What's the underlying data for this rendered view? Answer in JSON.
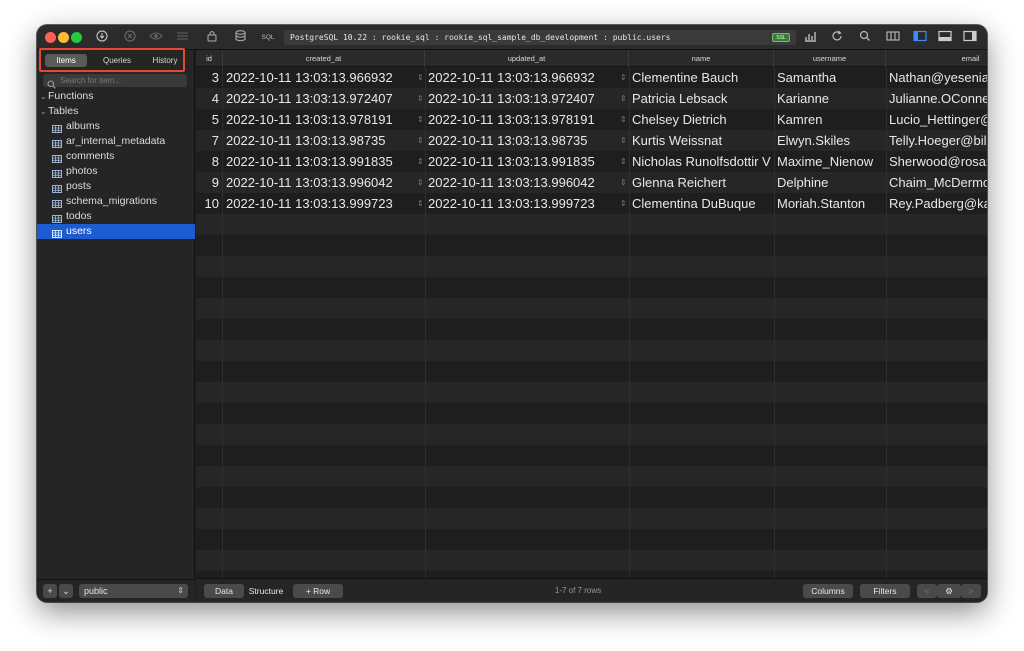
{
  "connection": {
    "path": "PostgreSQL 10.22 : rookie_sql : rookie_sql_sample_db_development : public.users",
    "badge": "SSL",
    "sql_label": "SQL"
  },
  "sidebar": {
    "tabs": [
      "Items",
      "Queries",
      "History"
    ],
    "active_tab": "Items",
    "search_placeholder": "Search for item...",
    "groups": [
      {
        "label": "Functions"
      },
      {
        "label": "Tables"
      }
    ],
    "tables": [
      "albums",
      "ar_internal_metadata",
      "comments",
      "photos",
      "posts",
      "schema_migrations",
      "todos",
      "users"
    ],
    "selected_table": "users",
    "schema": "public",
    "add_label": "+",
    "options_label": "⌄",
    "chevron_down": "⌄"
  },
  "grid": {
    "columns": [
      "id",
      "created_at",
      "updated_at",
      "name",
      "username",
      "email"
    ],
    "rows": [
      [
        "3",
        "2022-10-11 13:03:13.966932",
        "2022-10-11 13:03:13.966932",
        "Clementine Bauch",
        "Samantha",
        "Nathan@yesenia."
      ],
      [
        "4",
        "2022-10-11 13:03:13.972407",
        "2022-10-11 13:03:13.972407",
        "Patricia Lebsack",
        "Karianne",
        "Julianne.OConne"
      ],
      [
        "5",
        "2022-10-11 13:03:13.978191",
        "2022-10-11 13:03:13.978191",
        "Chelsey Dietrich",
        "Kamren",
        "Lucio_Hettinger@"
      ],
      [
        "7",
        "2022-10-11 13:03:13.98735",
        "2022-10-11 13:03:13.98735",
        "Kurtis Weissnat",
        "Elwyn.Skiles",
        "Telly.Hoeger@bill"
      ],
      [
        "8",
        "2022-10-11 13:03:13.991835",
        "2022-10-11 13:03:13.991835",
        "Nicholas Runolfsdottir V",
        "Maxime_Nienow",
        "Sherwood@rosam"
      ],
      [
        "9",
        "2022-10-11 13:03:13.996042",
        "2022-10-11 13:03:13.996042",
        "Glenna Reichert",
        "Delphine",
        "Chaim_McDermo"
      ],
      [
        "10",
        "2022-10-11 13:03:13.999723",
        "2022-10-11 13:03:13.999723",
        "Clementina DuBuque",
        "Moriah.Stanton",
        "Rey.Padberg@ka"
      ]
    ]
  },
  "bottombar": {
    "data_label": "Data",
    "structure_label": "Structure",
    "row_label": "+ Row",
    "row_count": "1-7 of 7 rows",
    "columns_label": "Columns",
    "filters_label": "Filters",
    "prev_label": "<",
    "settings_label": "⚙",
    "next_label": ">"
  },
  "colors": {
    "accent": "#1c5bd0",
    "highlight_border": "#e64a2e",
    "window_bg": "#1e1e1e"
  }
}
